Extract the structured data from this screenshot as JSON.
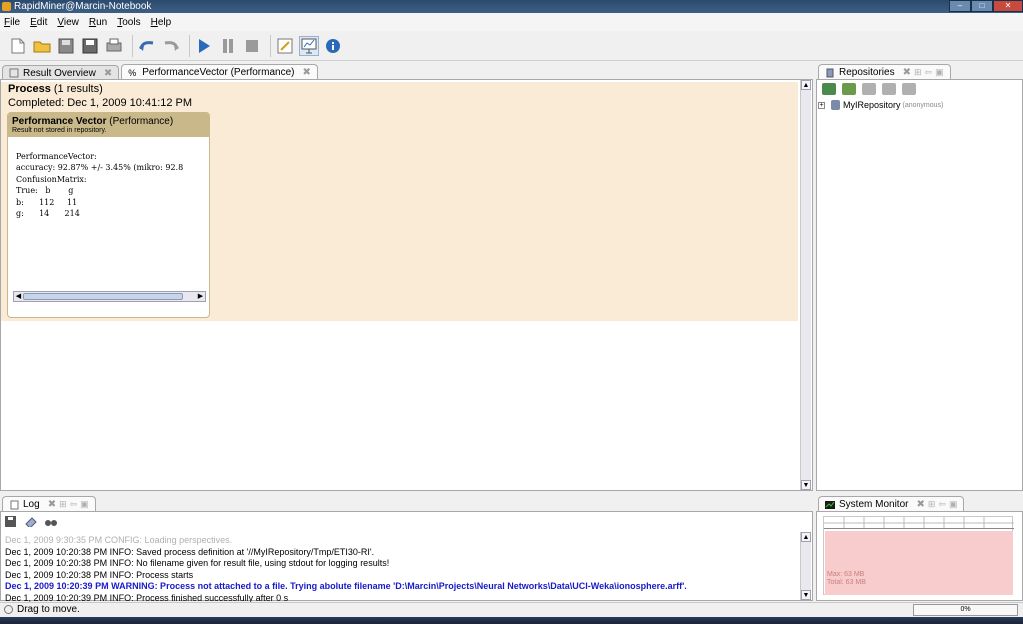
{
  "window": {
    "title": "RapidMiner@Marcin-Notebook",
    "minimize": "–",
    "maximize": "□",
    "close": "✕"
  },
  "menu": [
    "File",
    "Edit",
    "View",
    "Run",
    "Tools",
    "Help"
  ],
  "toolbar_icons": [
    "new-process-icon",
    "open-icon",
    "save-icon",
    "save-as-icon",
    "print-icon",
    "undo-icon",
    "redo-icon",
    "run-icon",
    "pause-icon",
    "stop-icon",
    "design-perspective-icon",
    "result-perspective-icon",
    "info-icon"
  ],
  "tabs": {
    "result_overview": "Result Overview",
    "performance_vector": "PerformanceVector (Performance)",
    "repositories": "Repositories",
    "log": "Log",
    "system_monitor": "System Monitor"
  },
  "process": {
    "title": "Process",
    "count": "(1 results)",
    "completed": "Completed: Dec 1, 2009 10:41:12 PM"
  },
  "card": {
    "title": "Performance Vector",
    "subtitle": "(Performance)",
    "note": "Result not stored in repository.",
    "content": "PerformanceVector:\naccuracy: 92.87% +/- 3.45% (mikro: 92.8\nConfusionMatrix:\nTrue:   b       g\nb:      112     11\ng:      14      214"
  },
  "repository": {
    "name": "MyIRepository",
    "note": "(anonymous)"
  },
  "log": [
    {
      "text": "Dec 1, 2009 9:30:35 PM CONFIG: Loading perspectives.",
      "style": "muted"
    },
    {
      "text": "Dec 1, 2009 10:20:38 PM INFO: Saved process definition at '//MyIRepository/Tmp/ETI30-RI'.",
      "style": "normal"
    },
    {
      "text": "Dec 1, 2009 10:20:38 PM INFO: No filename given for result file, using stdout for logging results!",
      "style": "normal"
    },
    {
      "text": "Dec 1, 2009 10:20:38 PM INFO: Process starts",
      "style": "normal"
    },
    {
      "text": "Dec 1, 2009 10:20:39 PM WARNING: Process not attached to a file. Trying abolute filename 'D:\\Marcin\\Projects\\Neural Networks\\Data\\UCI-Weka\\ionosphere.arff'.",
      "style": "warn"
    },
    {
      "text": "Dec 1, 2009 10:20:39 PM INFO: Process finished successfully after 0 s",
      "style": "normal"
    }
  ],
  "system_monitor": {
    "max": "Max:   63 MB",
    "total": "Total: 63 MB"
  },
  "status": {
    "text": "Drag to move.",
    "progress": "0%"
  }
}
